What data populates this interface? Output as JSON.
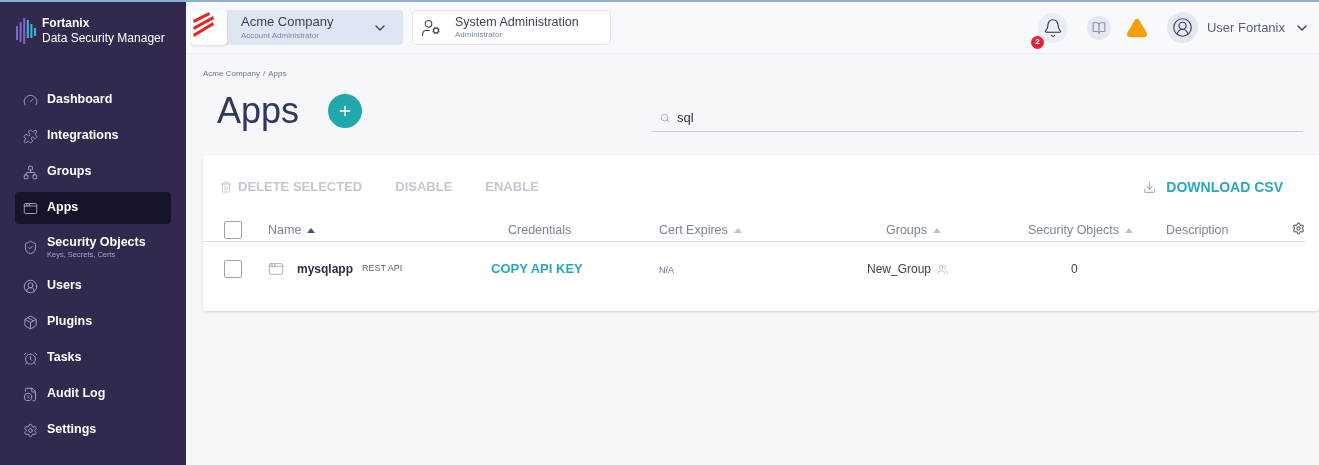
{
  "brand": {
    "name": "Fortanix",
    "product": "Data Security Manager"
  },
  "sidebar": {
    "items": [
      {
        "label": "Dashboard",
        "selected": false
      },
      {
        "label": "Integrations",
        "selected": false
      },
      {
        "label": "Groups",
        "selected": false
      },
      {
        "label": "Apps",
        "selected": true
      },
      {
        "label": "Security Objects",
        "sublabel": "Keys, Secrets, Certs",
        "selected": false
      },
      {
        "label": "Users",
        "selected": false
      },
      {
        "label": "Plugins",
        "selected": false
      },
      {
        "label": "Tasks",
        "selected": false
      },
      {
        "label": "Audit Log",
        "selected": false
      },
      {
        "label": "Settings",
        "selected": false
      }
    ]
  },
  "account": {
    "name": "Acme Company",
    "role": "Account Administrator"
  },
  "admin": {
    "name": "System Administration",
    "role": "Administrator"
  },
  "notifications": {
    "count": "2"
  },
  "user": {
    "name": "User Fortanix"
  },
  "breadcrumb": [
    "Acme Company",
    "/",
    "Apps"
  ],
  "page_title": "Apps",
  "search": {
    "value": "sql"
  },
  "toolbar": [
    {
      "label": "DELETE SELECTED",
      "disabled": true
    },
    {
      "label": "DISABLE",
      "disabled": true
    },
    {
      "label": "ENABLE",
      "disabled": true
    }
  ],
  "download": {
    "label": "DOWNLOAD CSV",
    "disabled": false
  },
  "table": {
    "select_all": {
      "checked": false
    },
    "columns": [
      {
        "label": "Name",
        "sortable": true,
        "sorted": true
      },
      {
        "label": "Credentials",
        "sortable": false
      },
      {
        "label": "Cert Expires",
        "sortable": true,
        "sorted": false
      },
      {
        "label": "Groups",
        "sortable": true,
        "sorted": false
      },
      {
        "label": "Security Objects",
        "sortable": true,
        "sorted": false
      },
      {
        "label": "Description",
        "sortable": false
      }
    ],
    "rows": [
      {
        "checked": false,
        "name": "mysqlapp",
        "type": "REST API",
        "credentials": "COPY API KEY",
        "cert_expires": "N/A",
        "group": "New_Group",
        "security_objects": "0"
      }
    ]
  }
}
